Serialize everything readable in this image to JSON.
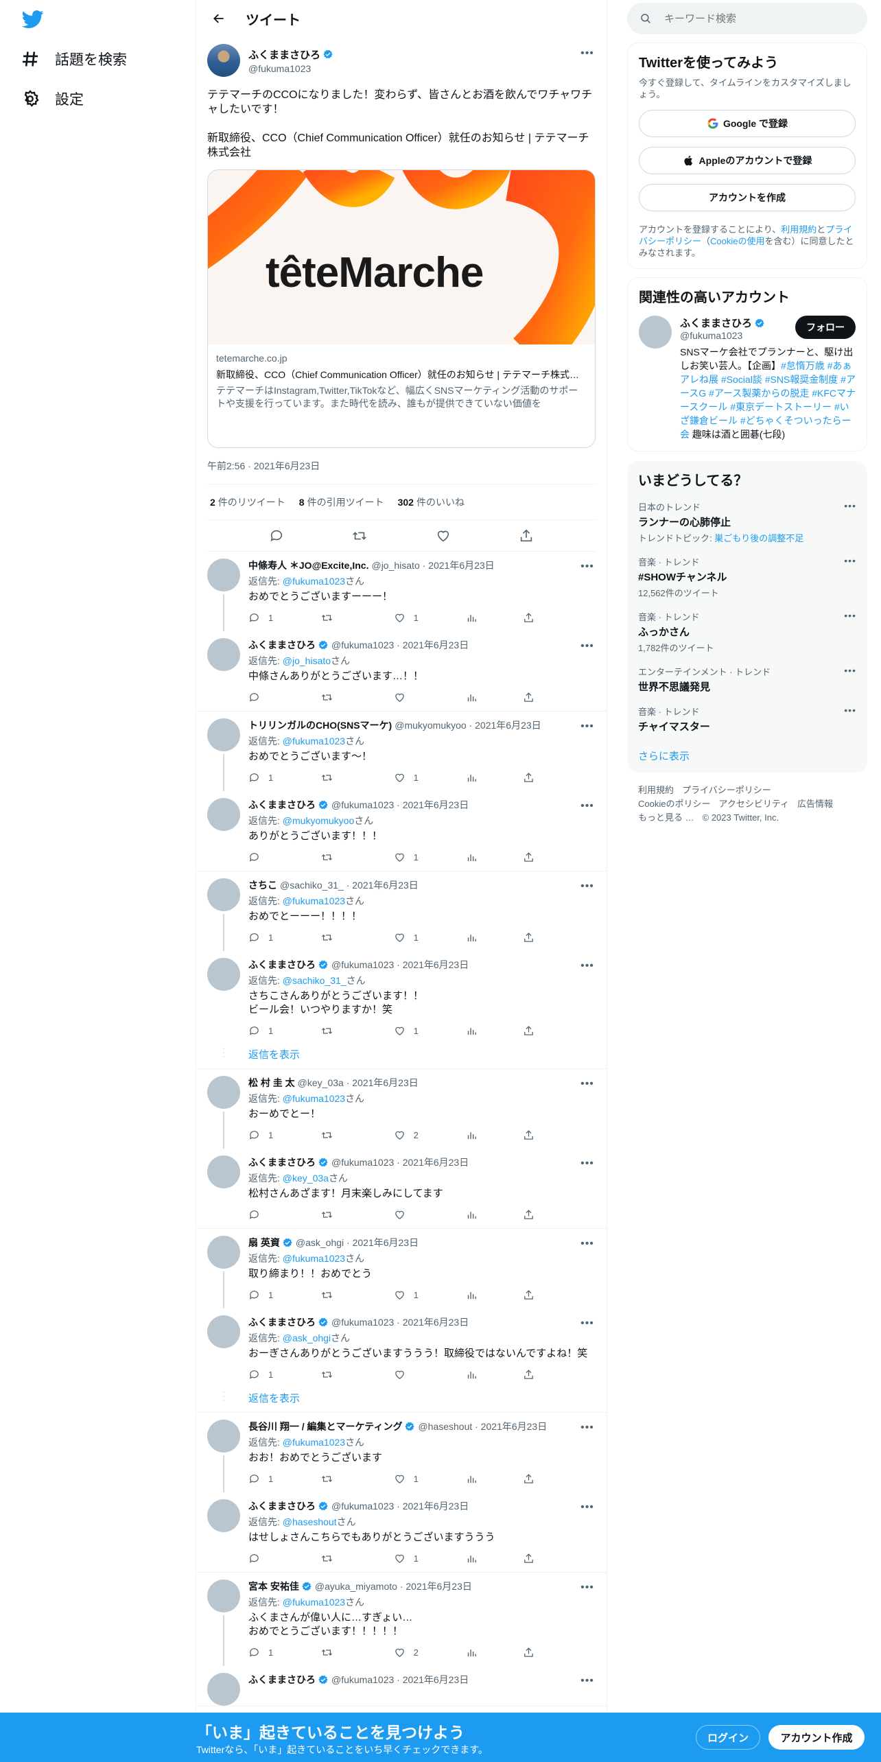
{
  "nav": {
    "explore_label": "話題を検索",
    "settings_label": "設定"
  },
  "header": {
    "title": "ツイート"
  },
  "focus_tweet": {
    "name": "ふくままさひろ",
    "handle": "@fukuma1023",
    "text": "テテマーチのCCOになりました！変わらず、皆さんとお酒を飲んでワチャワチャしたいです！\n\n新取締役、CCO（Chief Communication Officer）就任のお知らせ | テテマーチ株式会社",
    "card": {
      "wordmark": "têteMarche",
      "domain": "tetemarche.co.jp",
      "title": "新取締役、CCO（Chief Communication Officer）就任のお知らせ | テテマーチ株式会社",
      "description": "テテマーチはInstagram,Twitter,TikTokなど、幅広くSNSマーケティング活動のサポートや支援を行っています。また時代を読み、誰もが提供できていない価値を"
    },
    "time": "午前2:56 · 2021年6月23日",
    "stats": {
      "retweets": "2",
      "retweets_label": "件のリツイート",
      "quotes": "8",
      "quotes_label": "件の引用ツイート",
      "likes": "302",
      "likes_label": "件のいいね"
    }
  },
  "threads": [
    {
      "replies": [
        {
          "name": "中條寿人 ＊JO@Excite,Inc.",
          "verified": false,
          "meta": "@jo_hisato · 2021年6月23日",
          "reply_to_label": "返信先: ",
          "reply_to": "@fukuma1023",
          "reply_to_suffix": "さん",
          "text": "おめでとうございますーーー！",
          "replies": "1",
          "retweets": "",
          "likes": "1"
        },
        {
          "name": "ふくままさひろ",
          "verified": true,
          "meta": "@fukuma1023 · 2021年6月23日",
          "reply_to_label": "返信先: ",
          "reply_to": "@jo_hisato",
          "reply_to_suffix": "さん",
          "text": "中條さんありがとうございます…！！",
          "replies": "",
          "retweets": "",
          "likes": ""
        }
      ],
      "show_replies": ""
    },
    {
      "replies": [
        {
          "name": "トリリンガルのCHO(SNSマーケ)",
          "verified": false,
          "meta": "@mukyomukyoo · 2021年6月23日",
          "reply_to_label": "返信先: ",
          "reply_to": "@fukuma1023",
          "reply_to_suffix": "さん",
          "text": "おめでとうございます〜！",
          "replies": "1",
          "retweets": "",
          "likes": "1"
        },
        {
          "name": "ふくままさひろ",
          "verified": true,
          "meta": "@fukuma1023 · 2021年6月23日",
          "reply_to_label": "返信先: ",
          "reply_to": "@mukyomukyoo",
          "reply_to_suffix": "さん",
          "text": "ありがとうございます！！！",
          "replies": "",
          "retweets": "",
          "likes": "1"
        }
      ],
      "show_replies": ""
    },
    {
      "replies": [
        {
          "name": "さちこ",
          "verified": false,
          "meta": "@sachiko_31_ · 2021年6月23日",
          "reply_to_label": "返信先: ",
          "reply_to": "@fukuma1023",
          "reply_to_suffix": "さん",
          "text": "おめでとーーー！！！！",
          "replies": "1",
          "retweets": "",
          "likes": "1"
        },
        {
          "name": "ふくままさひろ",
          "verified": true,
          "meta": "@fukuma1023 · 2021年6月23日",
          "reply_to_label": "返信先: ",
          "reply_to": "@sachiko_31_",
          "reply_to_suffix": "さん",
          "text": "さちこさんありがとうございます！！\nビール会！いつやりますか！笑",
          "replies": "1",
          "retweets": "",
          "likes": "1"
        }
      ],
      "show_replies": "返信を表示"
    },
    {
      "replies": [
        {
          "name": "松 村 圭 太",
          "verified": false,
          "meta": "@key_03a · 2021年6月23日",
          "reply_to_label": "返信先: ",
          "reply_to": "@fukuma1023",
          "reply_to_suffix": "さん",
          "text": "おーめでとー！",
          "replies": "1",
          "retweets": "",
          "likes": "2"
        },
        {
          "name": "ふくままさひろ",
          "verified": true,
          "meta": "@fukuma1023 · 2021年6月23日",
          "reply_to_label": "返信先: ",
          "reply_to": "@key_03a",
          "reply_to_suffix": "さん",
          "text": "松村さんあざます！月末楽しみにしてます",
          "replies": "",
          "retweets": "",
          "likes": ""
        }
      ],
      "show_replies": ""
    },
    {
      "replies": [
        {
          "name": "扇 英資",
          "verified": true,
          "meta": "@ask_ohgi · 2021年6月23日",
          "reply_to_label": "返信先: ",
          "reply_to": "@fukuma1023",
          "reply_to_suffix": "さん",
          "text": "取り締まり！！おめでとう",
          "replies": "1",
          "retweets": "",
          "likes": "1"
        },
        {
          "name": "ふくままさひろ",
          "verified": true,
          "meta": "@fukuma1023 · 2021年6月23日",
          "reply_to_label": "返信先: ",
          "reply_to": "@ask_ohgi",
          "reply_to_suffix": "さん",
          "text": "おーぎさんありがとうございますううう！取締役ではないんですよね！笑",
          "replies": "1",
          "retweets": "",
          "likes": ""
        }
      ],
      "show_replies": "返信を表示"
    },
    {
      "replies": [
        {
          "name": "長谷川 翔一 / 編集とマーケティング",
          "verified": true,
          "meta": "@haseshout · 2021年6月23日",
          "reply_to_label": "返信先: ",
          "reply_to": "@fukuma1023",
          "reply_to_suffix": "さん",
          "text": "おお！おめでとうございます",
          "replies": "1",
          "retweets": "",
          "likes": "1"
        },
        {
          "name": "ふくままさひろ",
          "verified": true,
          "meta": "@fukuma1023 · 2021年6月23日",
          "reply_to_label": "返信先: ",
          "reply_to": "@haseshout",
          "reply_to_suffix": "さん",
          "text": "はせしょさんこちらでもありがとうございますううう",
          "replies": "",
          "retweets": "",
          "likes": "1"
        }
      ],
      "show_replies": ""
    },
    {
      "replies": [
        {
          "name": "宮本 安祐佳",
          "verified": true,
          "meta": "@ayuka_miyamoto · 2021年6月23日",
          "reply_to_label": "返信先: ",
          "reply_to": "@fukuma1023",
          "reply_to_suffix": "さん",
          "text": "ふくまさんが偉い人に…すぎょい…\nおめでとうございます！！！！！",
          "replies": "1",
          "retweets": "",
          "likes": "2"
        },
        {
          "name": "ふくままさひろ",
          "verified": true,
          "meta": "@fukuma1023 · 2021年6月23日",
          "reply_to_label": "",
          "reply_to": "",
          "reply_to_suffix": "",
          "text": "",
          "replies": "",
          "retweets": "",
          "likes": ""
        }
      ],
      "show_replies": ""
    }
  ],
  "right": {
    "search_placeholder": "キーワード検索",
    "signup": {
      "title": "Twitterを使ってみよう",
      "subtitle": "今すぐ登録して、タイムラインをカスタマイズしましょう。",
      "google_label": "Google で登録",
      "apple_label": "Appleのアカウントで登録",
      "create_label": "アカウントを作成",
      "legal_pre": "アカウントを登録することにより、",
      "legal_terms": "利用規約",
      "legal_and": "と",
      "legal_privacy": "プライバシーポリシー",
      "legal_mid": "（",
      "legal_cookie": "Cookieの使用",
      "legal_post": "を含む）に同意したとみなされます。"
    },
    "related": {
      "title": "関連性の高いアカウント",
      "name": "ふくままさひろ",
      "handle": "@fukuma1023",
      "follow_label": "フォロー",
      "bio_text": "SNSマーケ会社でプランナーと、駆け出しお笑い芸人。【企画】",
      "bio_tags": "#怠惰万歳 #あぁアレね展 #Social談 #SNS報奨金制度 #アースG #アース製薬からの脱走 #KFCマナースクール #東京デートストーリー #いざ鎌倉ビール #どちゃくそついったらー会",
      "bio_tail": " 趣味は酒と囲碁(七段)"
    },
    "trends": {
      "title": "いまどうしてる？",
      "items": [
        {
          "context": "日本のトレンド",
          "name": "ランナーの心肺停止",
          "extra_label": "トレンドトピック: ",
          "extra_link": "巣ごもり後の調整不足"
        },
        {
          "context": "音楽 · トレンド",
          "name": "#SHOWチャンネル",
          "extra_label": "12,562件のツイート",
          "extra_link": ""
        },
        {
          "context": "音楽 · トレンド",
          "name": "ふっかさん",
          "extra_label": "1,782件のツイート",
          "extra_link": ""
        },
        {
          "context": "エンターテインメント · トレンド",
          "name": "世界不思議発見",
          "extra_label": "",
          "extra_link": ""
        },
        {
          "context": "音楽 · トレンド",
          "name": "チャイマスター",
          "extra_label": "",
          "extra_link": ""
        }
      ],
      "show_more": "さらに表示"
    },
    "footer": [
      "利用規約",
      "プライバシーポリシー",
      "Cookieのポリシー",
      "アクセシビリティ",
      "広告情報",
      "もっと見る …",
      "© 2023 Twitter, Inc."
    ]
  },
  "bottom_bar": {
    "title": "「いま」起きていることを見つけよう",
    "subtitle": "Twitterなら、「いま」起きていることをいち早くチェックできます。",
    "login_label": "ログイン",
    "signup_label": "アカウント作成"
  },
  "colors": {
    "accent": "#1d9bf0",
    "text": "#0f1419",
    "muted": "#536471"
  }
}
